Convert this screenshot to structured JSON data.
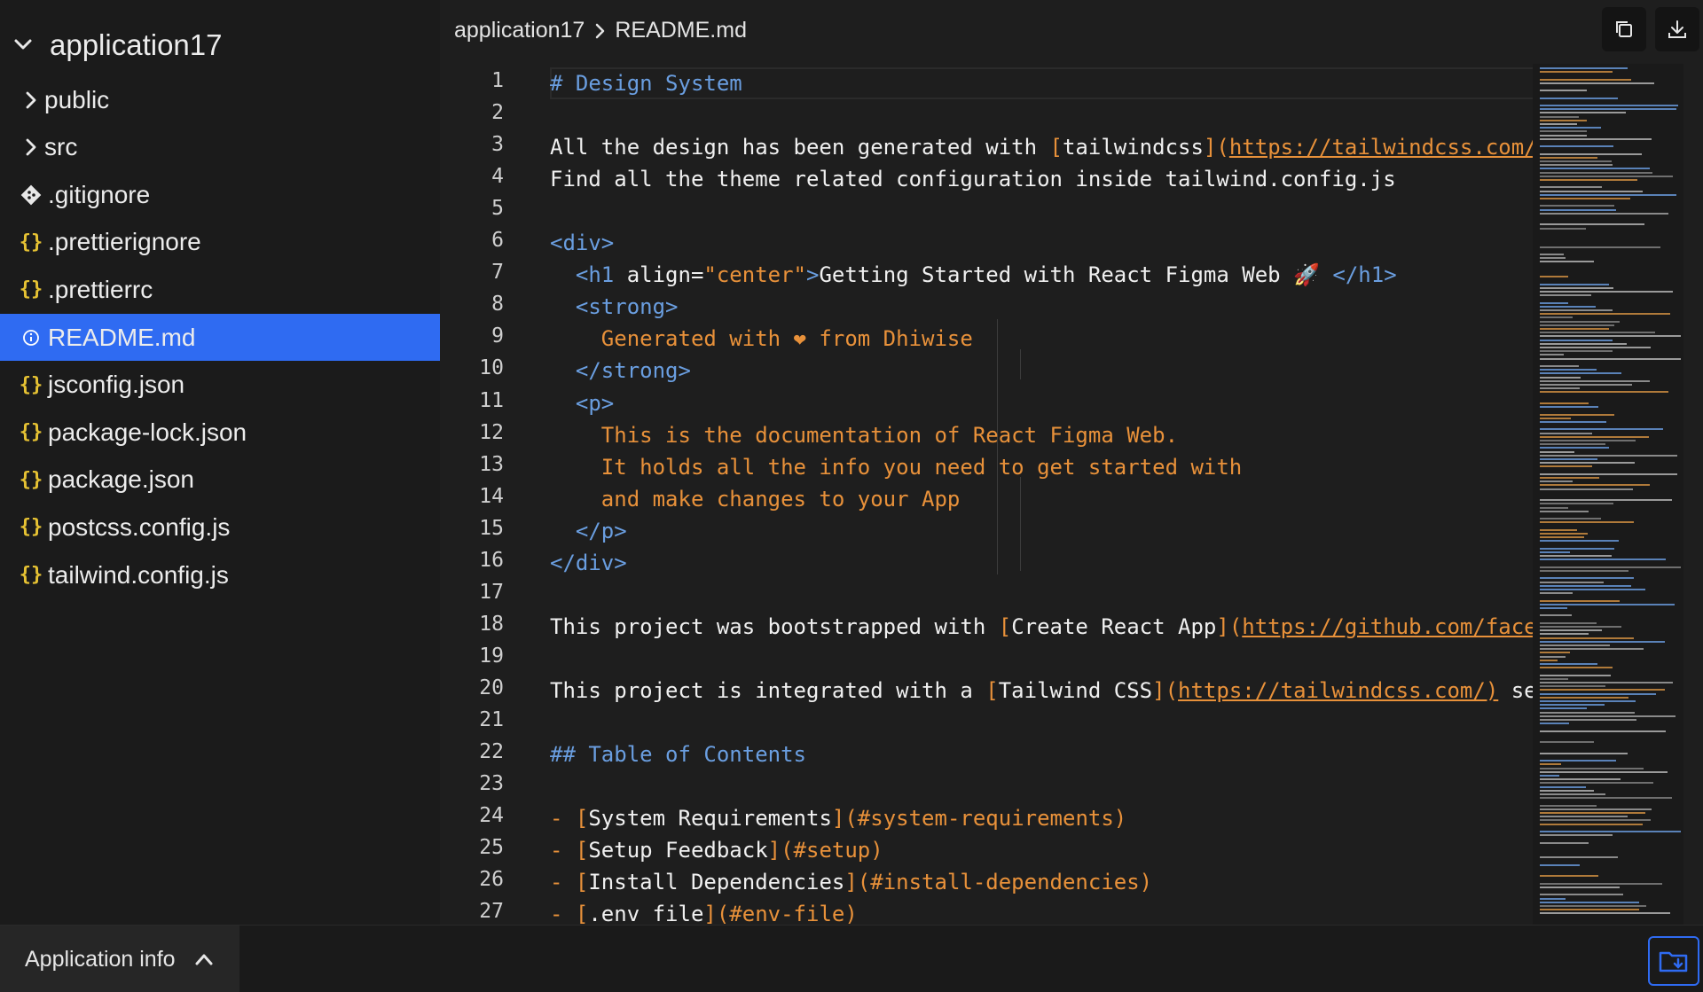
{
  "sidebar": {
    "root": "application17",
    "items": [
      {
        "label": "public",
        "type": "folder",
        "icon": "chevron-right-icon"
      },
      {
        "label": "src",
        "type": "folder",
        "icon": "chevron-right-icon"
      },
      {
        "label": ".gitignore",
        "type": "file",
        "icon": "git-icon"
      },
      {
        "label": ".prettierignore",
        "type": "file",
        "icon": "braces-icon",
        "glyph": "{}"
      },
      {
        "label": ".prettierrc",
        "type": "file",
        "icon": "braces-icon",
        "glyph": "{}"
      },
      {
        "label": "README.md",
        "type": "file",
        "icon": "info-icon",
        "glyph": "ⓘ",
        "active": true
      },
      {
        "label": "jsconfig.json",
        "type": "file",
        "icon": "braces-icon",
        "glyph": "{}"
      },
      {
        "label": "package-lock.json",
        "type": "file",
        "icon": "braces-icon",
        "glyph": "{}"
      },
      {
        "label": "package.json",
        "type": "file",
        "icon": "braces-icon",
        "glyph": "{}"
      },
      {
        "label": "postcss.config.js",
        "type": "file",
        "icon": "braces-icon",
        "glyph": "{}"
      },
      {
        "label": "tailwind.config.js",
        "type": "file",
        "icon": "braces-icon",
        "glyph": "{}"
      }
    ]
  },
  "header": {
    "breadcrumb": [
      "application17",
      "README.md"
    ],
    "buttons": [
      "copy-icon",
      "download-icon"
    ]
  },
  "editor": {
    "lines": [
      [
        [
          "b",
          "# Design System"
        ]
      ],
      [],
      [
        [
          "p",
          "All the design has been generated with "
        ],
        [
          "o",
          "["
        ],
        [
          "p",
          "tailwindcss"
        ],
        [
          "o",
          "]("
        ],
        [
          "u",
          "https://tailwindcss.com/"
        ]
      ],
      [
        [
          "p",
          "Find all the theme related configuration inside tailwind.config.js"
        ]
      ],
      [],
      [
        [
          "b",
          "<div>"
        ]
      ],
      [
        [
          "p",
          "  "
        ],
        [
          "b",
          "<h1 "
        ],
        [
          "p",
          "align="
        ],
        [
          "o",
          "\"center\""
        ],
        [
          "b",
          ">"
        ],
        [
          "p",
          "Getting Started with React Figma Web 🚀 "
        ],
        [
          "b",
          "</h1>"
        ]
      ],
      [
        [
          "p",
          "  "
        ],
        [
          "b",
          "<strong>"
        ]
      ],
      [
        [
          "p",
          "    "
        ],
        [
          "o",
          "Generated with ❤ from Dhiwise"
        ]
      ],
      [
        [
          "p",
          "  "
        ],
        [
          "b",
          "</strong>"
        ]
      ],
      [
        [
          "p",
          "  "
        ],
        [
          "b",
          "<p>"
        ]
      ],
      [
        [
          "p",
          "    "
        ],
        [
          "o",
          "This is the documentation of React Figma Web."
        ]
      ],
      [
        [
          "p",
          "    "
        ],
        [
          "o",
          "It holds all the info you need to get started with"
        ]
      ],
      [
        [
          "p",
          "    "
        ],
        [
          "o",
          "and make changes to your App"
        ]
      ],
      [
        [
          "p",
          "  "
        ],
        [
          "b",
          "</p>"
        ]
      ],
      [
        [
          "b",
          "</div>"
        ]
      ],
      [],
      [
        [
          "p",
          "This project was bootstrapped with "
        ],
        [
          "o",
          "["
        ],
        [
          "p",
          "Create React App"
        ],
        [
          "o",
          "]("
        ],
        [
          "u",
          "https://github.com/face"
        ]
      ],
      [],
      [
        [
          "p",
          "This project is integrated with a "
        ],
        [
          "o",
          "["
        ],
        [
          "p",
          "Tailwind CSS"
        ],
        [
          "o",
          "]("
        ],
        [
          "u",
          "https://tailwindcss.com/)"
        ],
        [
          "p",
          " se"
        ]
      ],
      [],
      [
        [
          "b",
          "## Table of Contents"
        ]
      ],
      [],
      [
        [
          "o",
          "- ["
        ],
        [
          "p",
          "System Requirements"
        ],
        [
          "o",
          "](#system-requirements)"
        ]
      ],
      [
        [
          "o",
          "- ["
        ],
        [
          "p",
          "Setup Feedback"
        ],
        [
          "o",
          "](#setup)"
        ]
      ],
      [
        [
          "o",
          "- ["
        ],
        [
          "p",
          "Install Dependencies"
        ],
        [
          "o",
          "](#install-dependencies)"
        ]
      ],
      [
        [
          "o",
          "- ["
        ],
        [
          "p",
          ".env file"
        ],
        [
          "o",
          "](#env-file)"
        ]
      ]
    ]
  },
  "bottom": {
    "app_info_label": "Application info"
  }
}
